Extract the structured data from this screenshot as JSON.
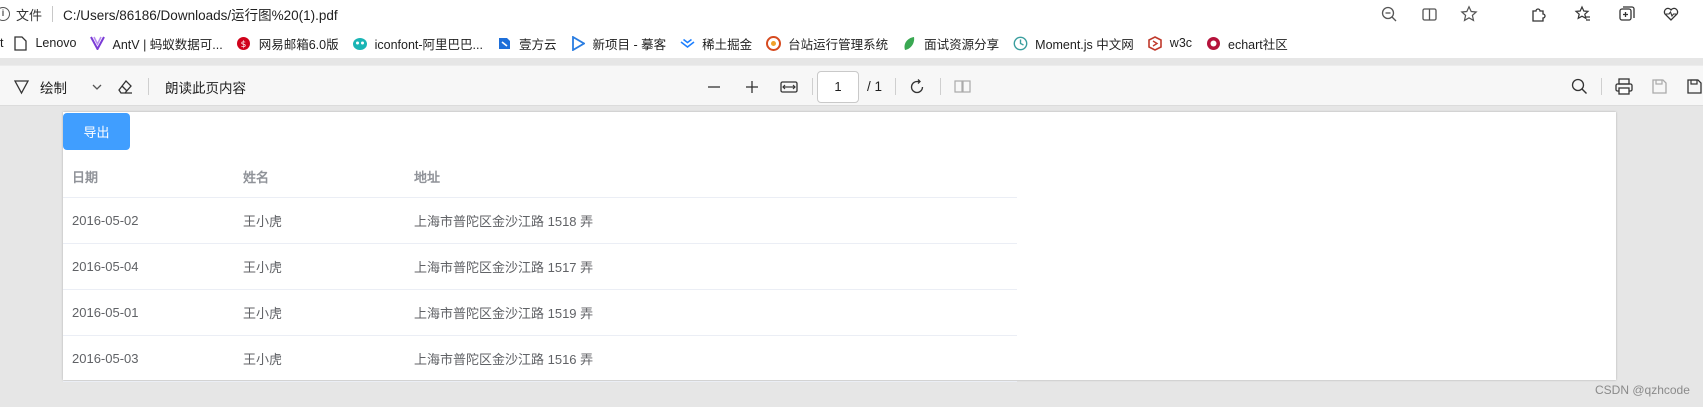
{
  "address_bar": {
    "info_label": "文件",
    "url": "C:/Users/86186/Downloads/运行图%20(1).pdf"
  },
  "bookmarks": [
    {
      "label": "Lenovo",
      "icon": "document-icon",
      "color": "#333333"
    },
    {
      "label": "AntV | 蚂蚁数据可...",
      "icon": "antv-logo-icon",
      "color": "#7b3bd6"
    },
    {
      "label": "网易邮箱6.0版",
      "icon": "netease-mail-icon",
      "color": "#d0021b"
    },
    {
      "label": "iconfont-阿里巴巴...",
      "icon": "iconfont-logo-icon",
      "color": "#1ab5b5"
    },
    {
      "label": "壹方云",
      "icon": "cloud-logo-icon",
      "color": "#1e6fd9"
    },
    {
      "label": "新项目 - 摹客",
      "icon": "play-logo-icon",
      "color": "#2a7de1"
    },
    {
      "label": "稀土掘金",
      "icon": "juejin-logo-icon",
      "color": "#1e80ff"
    },
    {
      "label": "台站运行管理系统",
      "icon": "swirl-logo-icon",
      "color": "#d64a1f"
    },
    {
      "label": "面试资源分享",
      "icon": "leaf-logo-icon",
      "color": "#3aa852"
    },
    {
      "label": "Moment.js 中文网",
      "icon": "clock-logo-icon",
      "color": "#3a9e9e"
    },
    {
      "label": "w3c",
      "icon": "w3c-logo-icon",
      "color": "#c0392b"
    },
    {
      "label": "echart社区",
      "icon": "echart-logo-icon",
      "color": "#b5123b"
    }
  ],
  "pdf_toolbar": {
    "draw_label": "绘制",
    "read_aloud_label": "朗读此页内容",
    "current_page": "1",
    "total_pages": "/ 1"
  },
  "document": {
    "export_button": "导出",
    "export_color": "#409eff",
    "columns": [
      "日期",
      "姓名",
      "地址"
    ],
    "rows": [
      [
        "2016-05-02",
        "王小虎",
        "上海市普陀区金沙江路 1518 弄"
      ],
      [
        "2016-05-04",
        "王小虎",
        "上海市普陀区金沙江路 1517 弄"
      ],
      [
        "2016-05-01",
        "王小虎",
        "上海市普陀区金沙江路 1519 弄"
      ],
      [
        "2016-05-03",
        "王小虎",
        "上海市普陀区金沙江路 1516 弄"
      ]
    ]
  },
  "watermark": "CSDN @qzhcode"
}
